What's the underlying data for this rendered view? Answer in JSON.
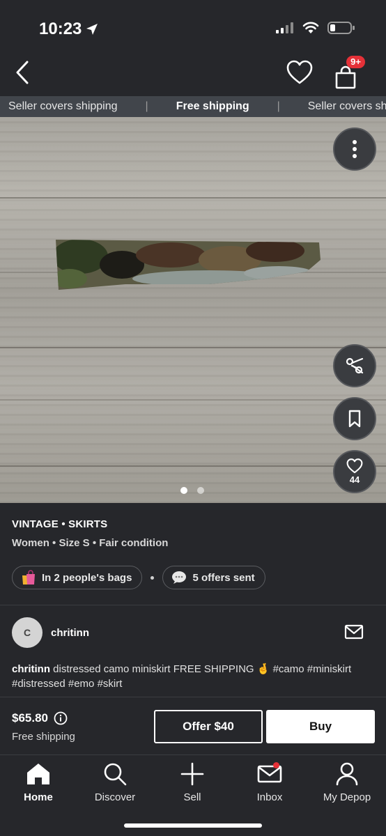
{
  "status": {
    "time": "10:23",
    "icons": [
      "location-arrow-icon",
      "cellular-signal-icon",
      "wifi-icon",
      "battery-icon"
    ]
  },
  "header": {
    "back_icon": "chevron-left-icon",
    "like_icon": "heart-icon",
    "bag_icon": "shopping-bag-icon",
    "bag_badge": "9+"
  },
  "ticker": {
    "items": [
      "Seller covers shipping",
      "|",
      "Free shipping",
      "|",
      "Seller covers shipping"
    ]
  },
  "photo": {
    "actions": {
      "more_icon": "more-vertical-icon",
      "split_icon": "scissors-icon",
      "save_icon": "bookmark-icon",
      "like_icon": "heart-icon",
      "like_count": "44"
    },
    "pages": 2,
    "current_page": 1
  },
  "listing": {
    "category": "VINTAGE • SKIRTS",
    "details": "Women • Size S • Fair condition",
    "bags_chip": "In 2 people's bags",
    "offers_chip": "5 offers sent"
  },
  "seller": {
    "avatar_initial": "C",
    "name": "chritinn"
  },
  "description": {
    "user": "chritinn",
    "text": " distressed camo miniskirt FREE SHIPPING 🤞 #camo #miniskirt #distressed #emo #skirt"
  },
  "purchase": {
    "price": "$65.80",
    "shipping": "Free shipping",
    "offer_label": "Offer $40",
    "buy_label": "Buy"
  },
  "tabs": [
    {
      "label": "Home",
      "icon": "home-icon"
    },
    {
      "label": "Discover",
      "icon": "search-icon"
    },
    {
      "label": "Sell",
      "icon": "plus-icon"
    },
    {
      "label": "Inbox",
      "icon": "mail-icon"
    },
    {
      "label": "My Depop",
      "icon": "user-icon"
    }
  ],
  "colors": {
    "background": "#26272b",
    "ticker": "#41454b",
    "badge": "#e53138"
  }
}
